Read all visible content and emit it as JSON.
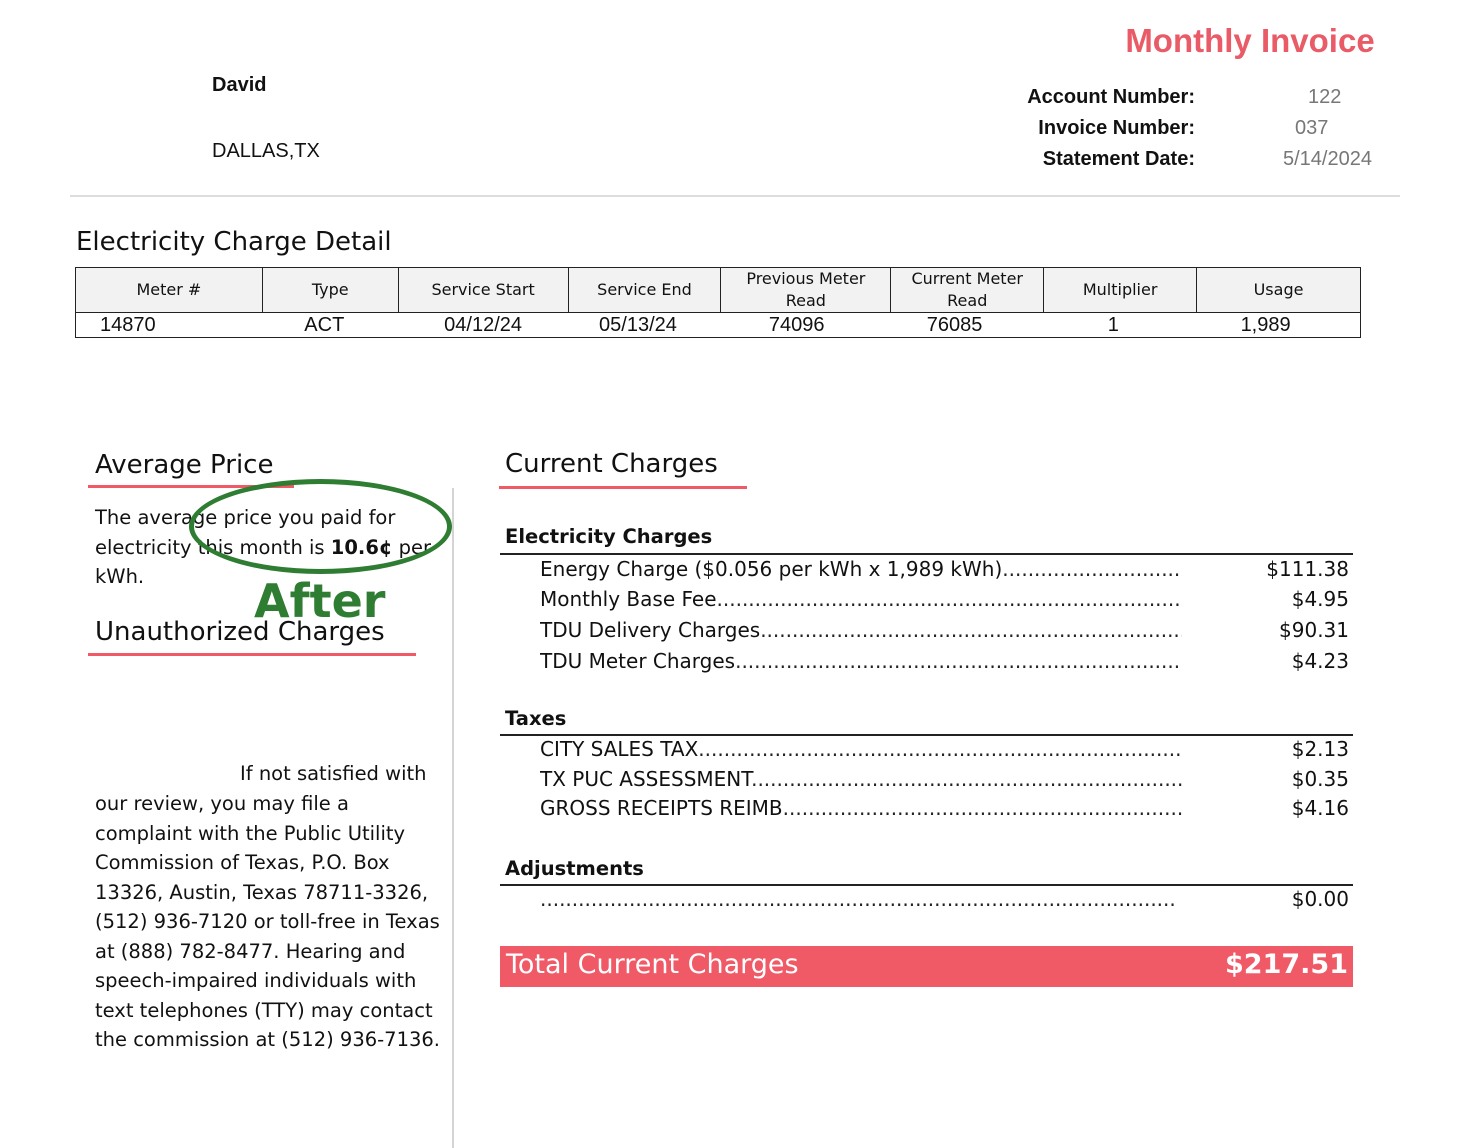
{
  "header": {
    "title": "Monthly Invoice",
    "customer_name": "David",
    "customer_city": "DALLAS,TX",
    "account": [
      {
        "label": "Account Number:",
        "value": "122"
      },
      {
        "label": "Invoice Number:",
        "value": "037"
      },
      {
        "label": "Statement Date:",
        "value": "5/14/2024"
      }
    ]
  },
  "colors": {
    "accent_red": "#f05a67",
    "title_red": "#e95b67",
    "stamp_green": "#2e7d32"
  },
  "detail": {
    "heading": "Electricity Charge Detail",
    "columns": [
      "Meter #",
      "Type",
      "Service Start",
      "Service End",
      "Previous Meter Read",
      "Current Meter Read",
      "Multiplier",
      "Usage"
    ],
    "row": [
      "14870",
      "ACT",
      "04/12/24",
      "05/13/24",
      "74096",
      "76085",
      "1",
      "1,989"
    ]
  },
  "average_price": {
    "heading": "Average Price",
    "text_pre": "The average price you paid for electricity this month is ",
    "price": "10.6¢",
    "text_post": " per kWh.",
    "stamp": "After"
  },
  "unauthorized": {
    "heading": "Unauthorized Charges",
    "first_line": "If not satisfied with",
    "body": "our review, you may file a complaint with the Public Utility Commission of Texas, P.O. Box 13326, Austin, Texas 78711-3326, (512) 936-7120 or toll-free in Texas at (888) 782-8477.  Hearing and speech-impaired individuals with text telephones (TTY) may contact the commission at (512) 936-7136."
  },
  "current_charges": {
    "heading": "Current Charges",
    "groups": [
      {
        "name": "Electricity Charges",
        "items": [
          {
            "label": "Energy Charge ($0.056 per kWh x 1,989 kWh)",
            "amount": "$111.38"
          },
          {
            "label": "Monthly Base Fee",
            "amount": "$4.95"
          },
          {
            "label": "TDU Delivery Charges",
            "amount": "$90.31"
          },
          {
            "label": "TDU Meter Charges",
            "amount": "$4.23"
          }
        ]
      },
      {
        "name": "Taxes",
        "items": [
          {
            "label": "CITY SALES TAX",
            "amount": "$2.13"
          },
          {
            "label": "TX PUC ASSESSMENT",
            "amount": "$0.35"
          },
          {
            "label": "GROSS RECEIPTS REIMB",
            "amount": "$4.16"
          }
        ]
      },
      {
        "name": "Adjustments",
        "items": [
          {
            "label": "",
            "amount": "$0.00"
          }
        ]
      }
    ],
    "total_label": "Total Current Charges",
    "total_amount": "$217.51"
  }
}
